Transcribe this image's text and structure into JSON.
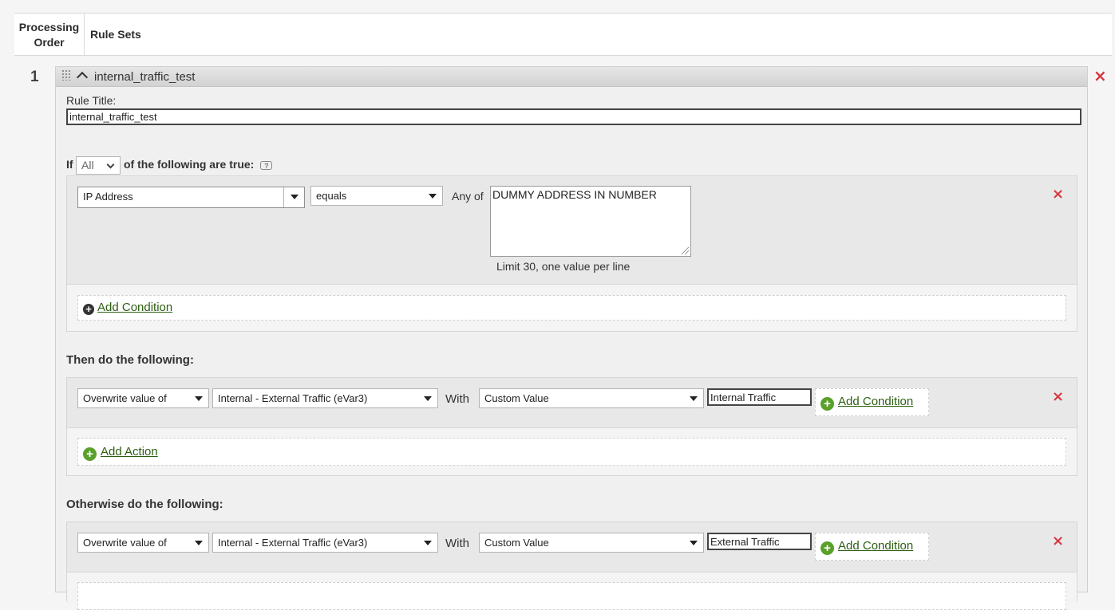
{
  "table_header": {
    "processing_order": "Processing Order",
    "processing_order_line1": "Processing",
    "processing_order_line2": "Order",
    "rule_sets": "Rule Sets"
  },
  "ruleset": {
    "order": "1",
    "title": "internal_traffic_test",
    "rule_title_label": "Rule Title:",
    "rule_title_value": "internal_traffic_test",
    "if_label": "If",
    "match_mode": "All",
    "following_true": "of the following are true:",
    "condition": {
      "field": "IP Address",
      "operator": "equals",
      "any_of_label": "Any of",
      "values_text": "DUMMY ADDRESS IN NUMBER",
      "hint": "Limit 30, one value per line"
    },
    "add_condition_label": "Add Condition",
    "then_label": "Then do the following:",
    "then_action": {
      "action": "Overwrite value of",
      "variable": "Internal - External Traffic (eVar3)",
      "with_label": "With",
      "value_type": "Custom Value",
      "value": "Internal Traffic",
      "add_condition_label": "Add Condition"
    },
    "add_action_label": "Add Action",
    "otherwise_label": "Otherwise do the following:",
    "otherwise_action": {
      "action": "Overwrite value of",
      "variable": "Internal - External Traffic (eVar3)",
      "with_label": "With",
      "value_type": "Custom Value",
      "value": "External Traffic",
      "add_condition_label": "Add Condition"
    }
  },
  "icons": {
    "remove": "×",
    "plus": "+",
    "help": "?"
  },
  "colors": {
    "remove_red": "#d7373f",
    "link_green": "#2c5e12",
    "add_green": "#5aa02c"
  }
}
